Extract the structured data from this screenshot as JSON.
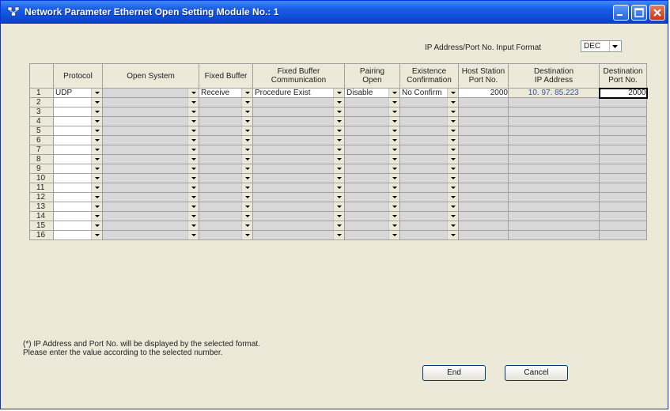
{
  "window": {
    "title": "Network Parameter  Ethernet Open Setting Module No.: 1"
  },
  "input_format": {
    "label": "IP Address/Port No. Input Format",
    "value": "DEC"
  },
  "table": {
    "headers": {
      "protocol": "Protocol",
      "open_system": "Open System",
      "fixed_buffer": "Fixed Buffer",
      "fbc_line1": "Fixed Buffer",
      "fbc_line2": "Communication",
      "pairing_line1": "Pairing",
      "pairing_line2": "Open",
      "exist_line1": "Existence",
      "exist_line2": "Confirmation",
      "host_line1": "Host Station",
      "host_line2": "Port No.",
      "dest_ip_line1": "Destination",
      "dest_ip_line2": "IP Address",
      "dest_port_line1": "Destination",
      "dest_port_line2": "Port No."
    },
    "rows": [
      {
        "num": "1",
        "protocol": "UDP",
        "open_system": "",
        "fixed_buffer": "Receive",
        "fbc": "Procedure Exist",
        "pairing": "Disable",
        "existence": "No Confirm",
        "host_port": "2000",
        "dest_ip": "10. 97. 85.223",
        "dest_port": "2000"
      },
      {
        "num": "2"
      },
      {
        "num": "3"
      },
      {
        "num": "4"
      },
      {
        "num": "5"
      },
      {
        "num": "6"
      },
      {
        "num": "7"
      },
      {
        "num": "8"
      },
      {
        "num": "9"
      },
      {
        "num": "10"
      },
      {
        "num": "11"
      },
      {
        "num": "12"
      },
      {
        "num": "13"
      },
      {
        "num": "14"
      },
      {
        "num": "15"
      },
      {
        "num": "16"
      }
    ]
  },
  "note": {
    "line1": "(*) IP Address and Port No. will be displayed by the selected format.",
    "line2": "Please enter the value according to the selected number."
  },
  "buttons": {
    "end": "End",
    "cancel": "Cancel"
  },
  "colors": {
    "titlebar": "#0a3fc2",
    "ip_text": "#2c52b8",
    "window_bg": "#ece9d8"
  }
}
